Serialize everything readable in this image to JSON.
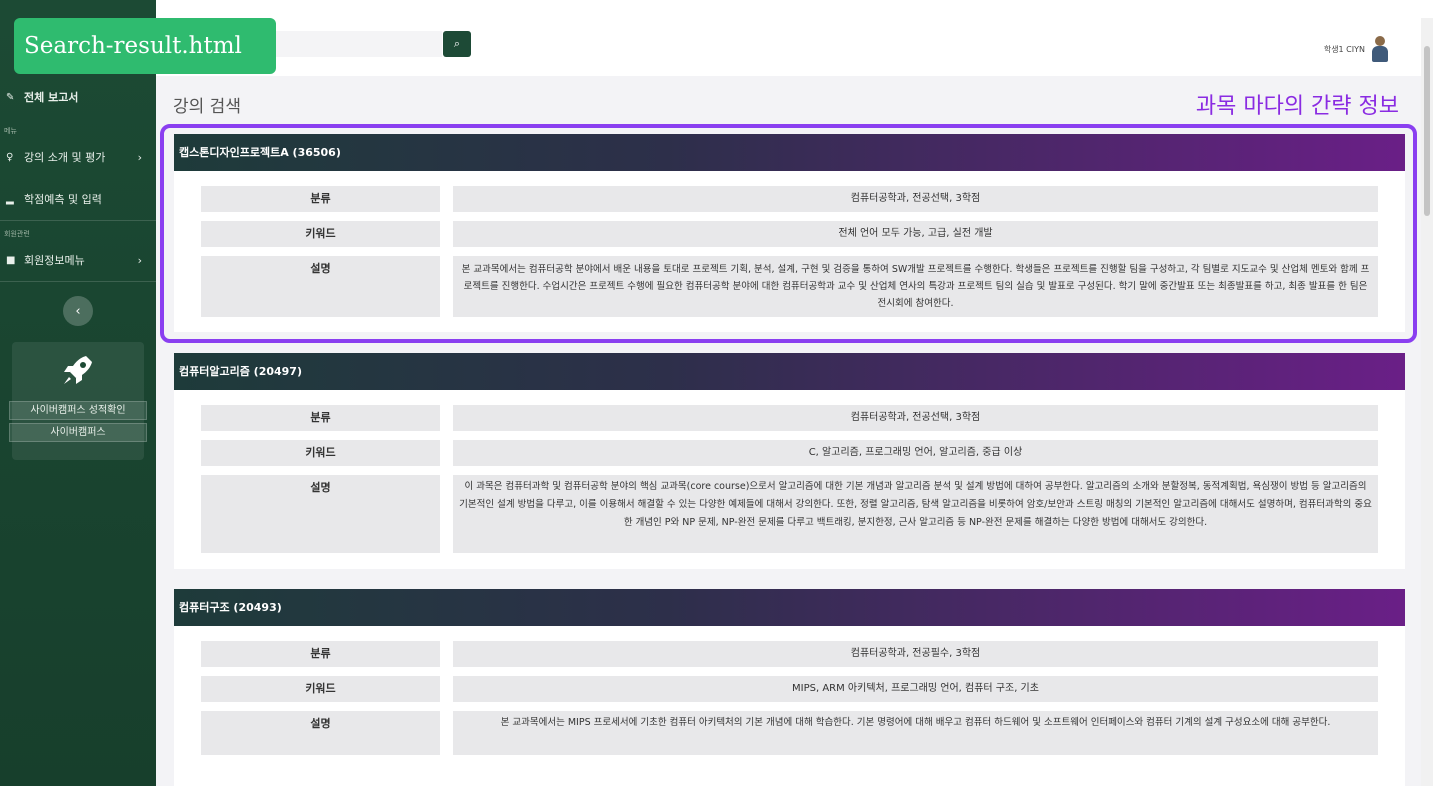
{
  "file_tab": "Search-result.html",
  "search": {
    "placeholder": ""
  },
  "user": {
    "name": "학생1 CIYN"
  },
  "annotation": "과목 마다의 간략 정보",
  "page_title": "강의 검색",
  "sidebar": {
    "top_item": "전체 보고서",
    "cat_menu": "메뉴",
    "items1": [
      {
        "label": "강의 소개 및 평가",
        "arrow": "›"
      },
      {
        "label": "학점예측 및 입력",
        "arrow": ""
      }
    ],
    "cat_member": "회원관련",
    "items2": [
      {
        "label": "회원정보메뉴",
        "arrow": "›"
      }
    ],
    "collapse": "‹",
    "promo_buttons": [
      "사이버캠퍼스 성적확인",
      "사이버캠퍼스"
    ]
  },
  "labels": {
    "category": "분류",
    "keyword": "키워드",
    "desc": "설명"
  },
  "courses": [
    {
      "title": "캡스톤디자인프로젝트A (36506)",
      "category": "컴퓨터공학과, 전공선택, 3학점",
      "keyword": "전체 언어 모두 가능, 고급, 실전 개발",
      "desc": "본 교과목에서는 컴퓨터공학 분야에서 배운 내용을 토대로 프로젝트 기획, 분석, 설계, 구현 및 검증을 통하여 SW개발 프로젝트를 수행한다. 학생들은 프로젝트를 진행할 팀을 구성하고, 각 팀별로 지도교수 및 산업체 멘토와 함께 프로젝트를 진행한다. 수업시간은 프로젝트 수행에 필요한 컴퓨터공학 분야에 대한 컴퓨터공학과 교수 및 산업체 연사의 특강과 프로젝트 팀의 실습 및 발표로 구성된다. 학기 말에 중간발표 또는 최종발표를 하고, 최종 발표를 한 팀은 전시회에 참여한다."
    },
    {
      "title": "컴퓨터알고리즘 (20497)",
      "category": "컴퓨터공학과, 전공선택, 3학점",
      "keyword": "C, 알고리즘, 프로그래밍 언어, 알고리즘, 중급 이상",
      "desc": "이 과목은 컴퓨터과학 및 컴퓨터공학 분야의 핵심 교과목(core course)으로서 알고리즘에 대한 기본 개념과 알고리즘 분석 및 설계 방법에 대하여 공부한다. 알고리즘의 소개와 분할정복, 동적계획법, 욕심쟁이 방법 등 알고리즘의 기본적인 설계 방법을 다루고, 이를 이용해서 해결할 수 있는 다양한 예제들에 대해서 강의한다. 또한, 정렬 알고리즘, 탐색 알고리즘을 비롯하여 암호/보안과 스트링 매칭의 기본적인 알고리즘에 대해서도 설명하며, 컴퓨터과학의 중요한 개념인 P와 NP 문제, NP-완전 문제를 다루고 백트래킹, 분지한정, 근사 알고리즘 등 NP-완전 문제를 해결하는 다양한 방법에 대해서도 강의한다."
    },
    {
      "title": "컴퓨터구조 (20493)",
      "category": "컴퓨터공학과, 전공필수, 3학점",
      "keyword": "MIPS, ARM 아키텍처, 프로그래밍 언어, 컴퓨터 구조, 기초",
      "desc": "본 교과목에서는 MIPS 프로세서에 기초한 컴퓨터 아키텍처의 기본 개념에 대해 학습한다. 기본 명령어에 대해 배우고 컴퓨터 하드웨어 및 소프트웨어 인터페이스와 컴퓨터 기계의 설계 구성요소에 대해 공부한다."
    }
  ]
}
